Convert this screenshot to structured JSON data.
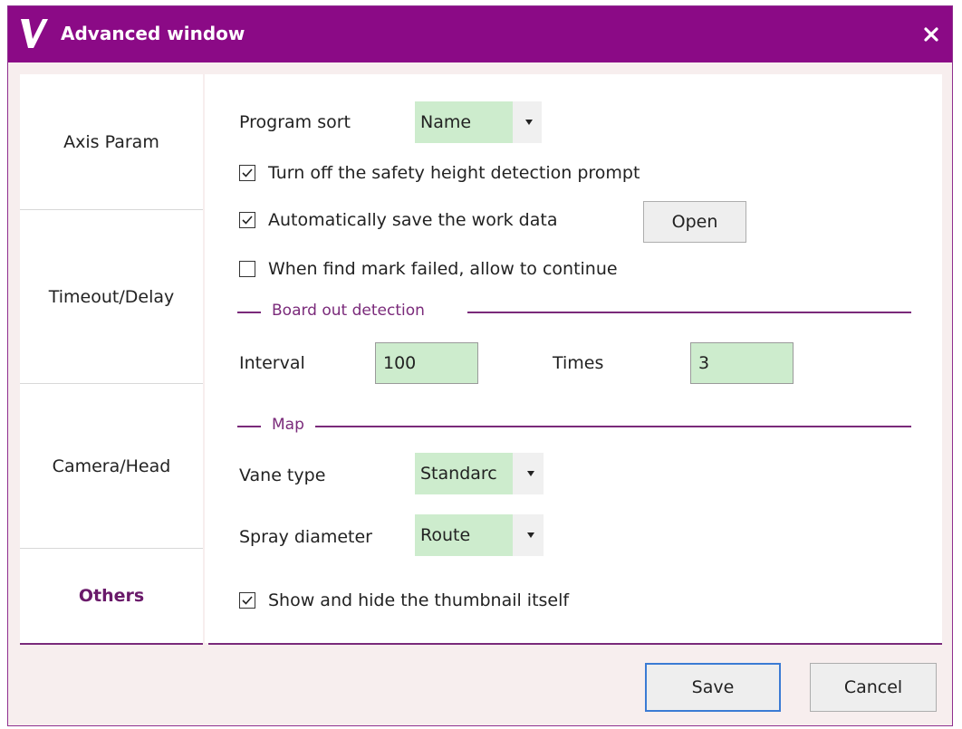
{
  "window": {
    "title": "Advanced window",
    "accent_color": "#8b0a86"
  },
  "sidebar": {
    "items": [
      {
        "label": "Axis Param"
      },
      {
        "label": "Timeout/Delay"
      },
      {
        "label": "Camera/Head"
      },
      {
        "label": "Others",
        "active": true
      }
    ]
  },
  "others": {
    "program_sort": {
      "label": "Program sort",
      "value": "Name"
    },
    "safety_height": {
      "label": "Turn off the safety height detection prompt",
      "checked": true
    },
    "auto_save": {
      "label": "Automatically save the work data",
      "checked": true,
      "button": "Open"
    },
    "find_mark": {
      "label": "When find mark failed, allow to continue",
      "checked": false
    },
    "board_out": {
      "title": "Board out detection",
      "interval_label": "Interval",
      "interval_value": "100",
      "times_label": "Times",
      "times_value": "3"
    },
    "map": {
      "title": "Map",
      "vane_type_label": "Vane type",
      "vane_type_value": "Standarc",
      "spray_label": "Spray diameter",
      "spray_value": "Route"
    },
    "thumbnail": {
      "label": "Show and hide the thumbnail itself",
      "checked": true
    }
  },
  "footer": {
    "save_label": "Save",
    "cancel_label": "Cancel"
  },
  "icons": {
    "logo": "v-logo-icon",
    "close": "close-icon",
    "check": "checkmark-icon",
    "dropdown": "chevron-down-icon"
  }
}
